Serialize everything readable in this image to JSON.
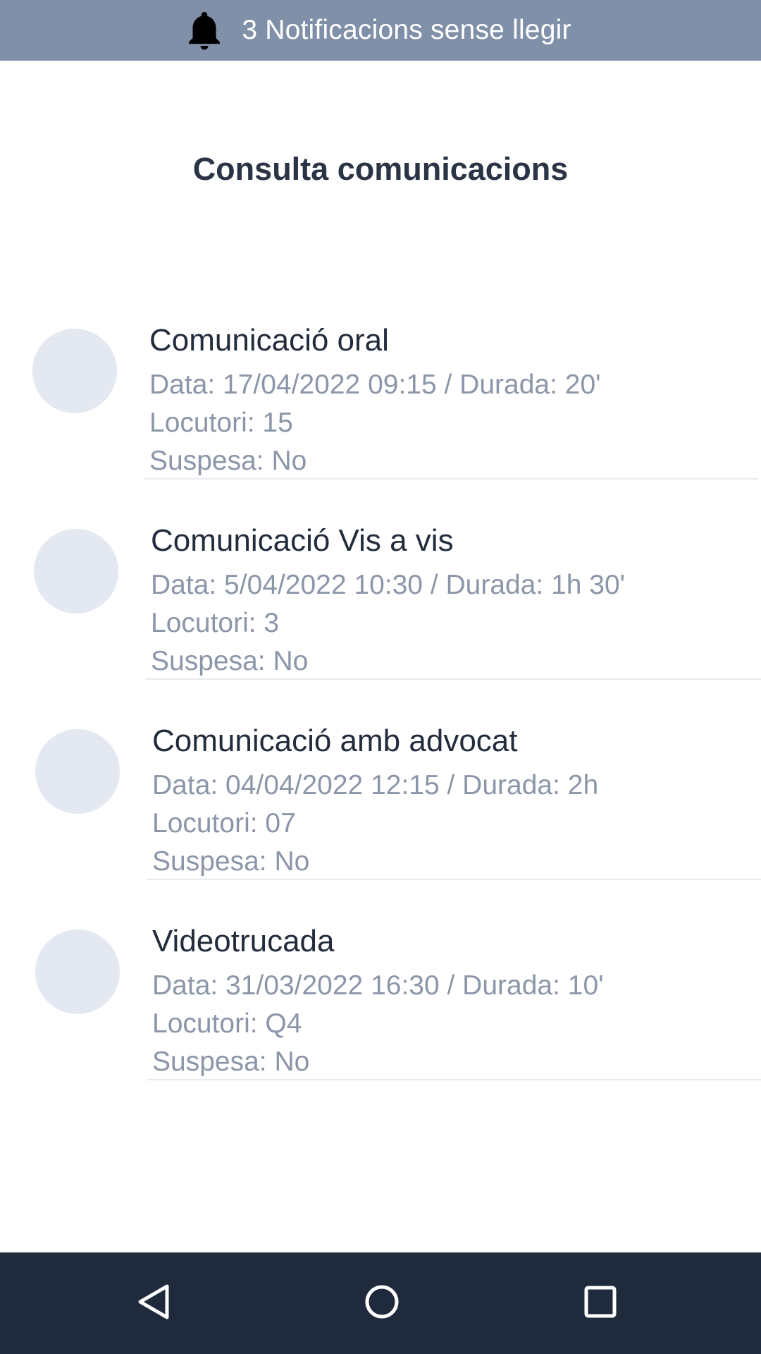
{
  "notification_bar": {
    "icon": "bell-icon",
    "text": "3 Notificacions sense llegir"
  },
  "page": {
    "title": "Consulta comunicacions"
  },
  "communications": [
    {
      "title": "Comunicació oral",
      "date_line": "Data: 17/04/2022 09:15 / Durada: 20'",
      "locutori": "Locutori: 15",
      "suspesa": "Suspesa: No"
    },
    {
      "title": "Comunicació Vis a vis",
      "date_line": "Data: 5/04/2022 10:30 / Durada: 1h 30'",
      "locutori": "Locutori: 3",
      "suspesa": "Suspesa: No"
    },
    {
      "title": "Comunicació amb advocat",
      "date_line": "Data: 04/04/2022 12:15 / Durada: 2h",
      "locutori": "Locutori: 07",
      "suspesa": "Suspesa: No"
    },
    {
      "title": "Videotrucada",
      "date_line": "Data: 31/03/2022 16:30 / Durada: 10'",
      "locutori": "Locutori: Q4",
      "suspesa": "Suspesa: No"
    }
  ],
  "system_nav": {
    "back_icon": "back-triangle-icon",
    "home_icon": "home-circle-icon",
    "recents_icon": "recents-square-icon"
  },
  "colors": {
    "notification_bg": "#8090a8",
    "title_text": "#2b3445",
    "secondary_text": "#8b96a8",
    "avatar_bg": "#e3e8f1",
    "nav_bg": "#1f2b3c"
  }
}
